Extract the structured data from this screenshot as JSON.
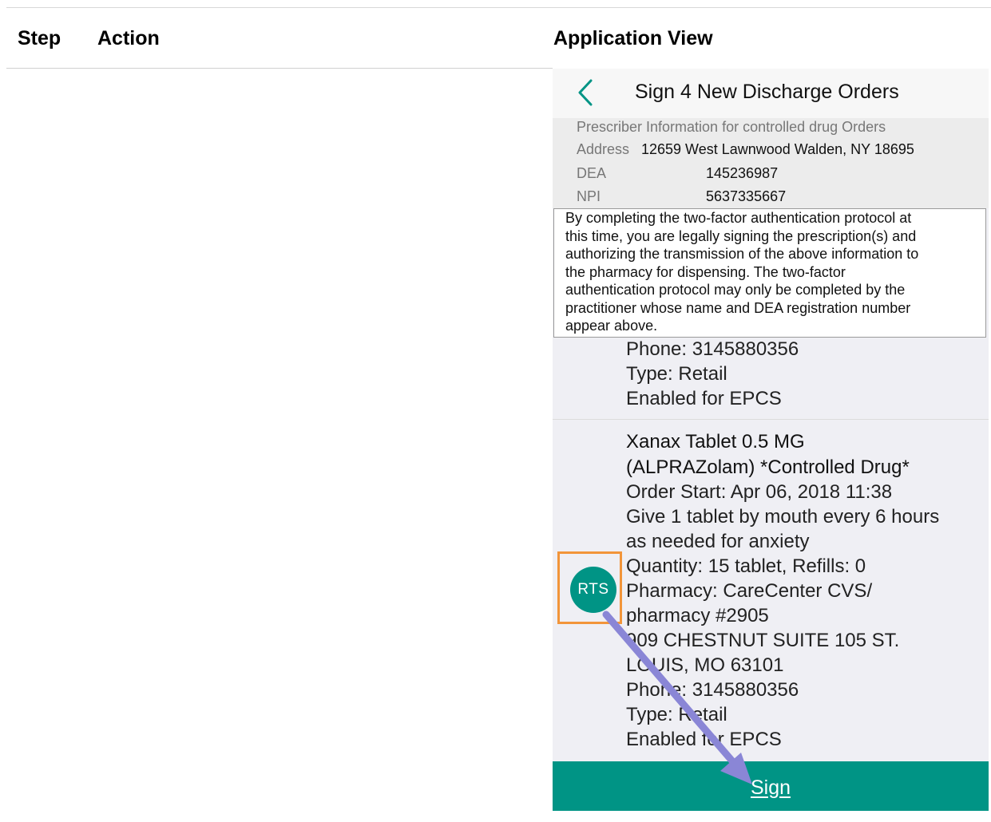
{
  "table": {
    "headers": {
      "step": "Step",
      "action": "Action",
      "application_view": "Application View"
    }
  },
  "app": {
    "title": "Sign 4 New Discharge Orders",
    "back_icon": "chevron-left-icon",
    "prescriber": {
      "heading": "Prescriber Information for controlled drug Orders",
      "address_label": "Address",
      "address_value": "12659 West Lawnwood Walden, NY 18695",
      "dea_label": "DEA",
      "dea_value": "145236987",
      "npi_label": "NPI",
      "npi_value": "5637335667"
    },
    "legal_text": "By completing the two-factor authentication protocol at\nthis time, you are legally signing the prescription(s) and\nauthorizing the transmission of the above information to\nthe pharmacy for dispensing.  The two-factor\nauthentication protocol may only be completed by the\npractitioner whose name and DEA registration number\nappear above.",
    "previous_order_tail": {
      "phone": "Phone: 3145880356",
      "type": "Type: Retail",
      "epcs": "Enabled for EPCS"
    },
    "order": {
      "drug_line1": "Xanax Tablet 0.5 MG",
      "drug_line2": "(ALPRAZolam) *Controlled Drug*",
      "order_start": "Order Start: Apr 06, 2018 11:38",
      "sig_line1": "Give 1 tablet by mouth every 6 hours",
      "sig_line2": "as needed for anxiety",
      "quantity": "Quantity: 15 tablet, Refills: 0",
      "pharmacy_line1": "Pharmacy: CareCenter CVS/",
      "pharmacy_line2": "pharmacy #2905",
      "address_line1": "909 CHESTNUT SUITE 105 ST.",
      "address_line2": "LOUIS, MO 63101",
      "phone": "Phone: 3145880356",
      "type": "Type: Retail",
      "epcs": "Enabled for EPCS",
      "badge": "RTS"
    },
    "sign_button": "Sign"
  },
  "colors": {
    "accent_teal": "#009485",
    "highlight_orange": "#f2953a",
    "arrow_purple": "#8a86d6"
  }
}
